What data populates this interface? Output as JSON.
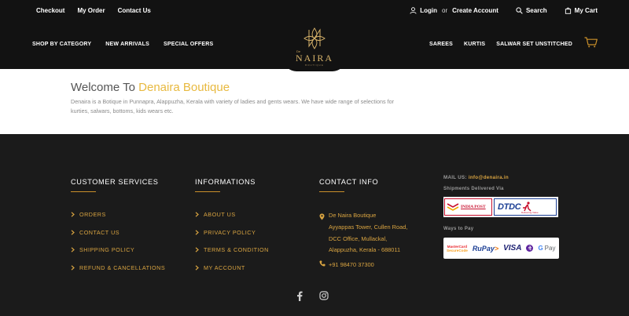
{
  "topbar": {
    "links": [
      "Checkout",
      "My Order",
      "Contact Us"
    ],
    "login": "Login",
    "or": "or",
    "create_account": "Create Account",
    "search": "Search",
    "cart": "My Cart"
  },
  "nav": {
    "left": [
      "SHOP BY CATEGORY",
      "NEW ARRIVALS",
      "SPECIAL OFFERS"
    ],
    "right": [
      "SAREES",
      "KURTIS",
      "SALWAR SET UNSTITCHED"
    ]
  },
  "logo": {
    "de": "De",
    "name": "NAIRA",
    "tagline": "BOUTIQUE"
  },
  "welcome": {
    "prefix": "Welcome To",
    "brand": "Denaira Boutique",
    "text": "Denaira is a Botique in Punnapra, Alappuzha, Kerala with variety of ladies and gents wears. We have wide range of selections for kurties, salwars, bottoms, kids wears etc."
  },
  "footer": {
    "customer_services": {
      "title": "CUSTOMER SERVICES",
      "items": [
        "ORDERS",
        "CONTACT US",
        "SHIPPING POLICY",
        "REFUND & CANCELLATIONS"
      ]
    },
    "informations": {
      "title": "INFORMATIONS",
      "items": [
        "ABOUT US",
        "PRIVACY POLICY",
        "TERMS & CONDITION",
        "MY ACCOUNT"
      ]
    },
    "contact": {
      "title": "CONTACT INFO",
      "address": [
        "De Naira Boutique",
        "Ayyappas Tower, Cullen Road,",
        "DCC Office, Mullackal,",
        "Alappuzha, Kerala - 688011"
      ],
      "phone": "+91 98470 37300"
    },
    "mail_label": "MAIL US:",
    "mail": "info@denaira.in",
    "shipments_label": "Shipments Delivered Via",
    "carriers": {
      "indiapost": "INDIA POST",
      "dtdc": "DTDC",
      "dtdc_sub": "Delivering Value"
    },
    "ways_label": "Ways to Pay",
    "payments": {
      "mastercard_1": "MasterCard",
      "mastercard_2": "SecureCode",
      "rupay_1": "RuPay",
      "rupay_2": ">",
      "visa": "VISA",
      "phonepe": "पे",
      "gpay_g": "G",
      "gpay_text": "Pay"
    }
  },
  "colors": {
    "gold": "#d9a441",
    "brand_yellow": "#e8b93f",
    "dark": "#121212",
    "footer_bg": "#1b1b1b"
  }
}
